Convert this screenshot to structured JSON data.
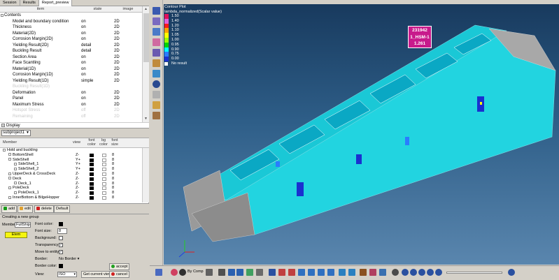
{
  "tabs": [
    "Session",
    "Results",
    "Report_preview"
  ],
  "grid1": {
    "headers": {
      "item": "item",
      "state": "state",
      "image": "image"
    },
    "rows": [
      {
        "item": "Contents",
        "state": "",
        "image": "",
        "group": true,
        "dim": false
      },
      {
        "item": "Model and boundary condition",
        "state": "on",
        "image": "2D",
        "group": false,
        "dim": false
      },
      {
        "item": "Thickness",
        "state": "on",
        "image": "2D",
        "group": false,
        "dim": false
      },
      {
        "item": "Material(2D)",
        "state": "on",
        "image": "2D",
        "group": false,
        "dim": false
      },
      {
        "item": "Corrosion Margin(2D)",
        "state": "on",
        "image": "2D",
        "group": false,
        "dim": false
      },
      {
        "item": "Yielding Result(2D)",
        "state": "detail",
        "image": "2D",
        "group": false,
        "dim": false
      },
      {
        "item": "Buckling Result",
        "state": "detail",
        "image": "2D",
        "group": false,
        "dim": false
      },
      {
        "item": "Section Area",
        "state": "on",
        "image": "2D",
        "group": false,
        "dim": false
      },
      {
        "item": "Face Scantling",
        "state": "on",
        "image": "2D",
        "group": false,
        "dim": false
      },
      {
        "item": "Material(1D)",
        "state": "on",
        "image": "2D",
        "group": false,
        "dim": false
      },
      {
        "item": "Corrosion Margin(1D)",
        "state": "on",
        "image": "2D",
        "group": false,
        "dim": false
      },
      {
        "item": "Yielding Result(1D)",
        "state": "simple",
        "image": "2D",
        "group": false,
        "dim": false
      },
      {
        "item": "Buckling Result(1D)",
        "state": "",
        "image": "",
        "group": false,
        "dim": true
      },
      {
        "item": "Deformation",
        "state": "on",
        "image": "2D",
        "group": false,
        "dim": false
      },
      {
        "item": "Panel",
        "state": "on",
        "image": "2D",
        "group": false,
        "dim": false
      },
      {
        "item": "Maximum Stress",
        "state": "on",
        "image": "2D",
        "group": false,
        "dim": false
      },
      {
        "item": "Hotspot Stress",
        "state": "off",
        "image": "2D",
        "group": false,
        "dim": true
      },
      {
        "item": "Remaining",
        "state": "off",
        "image": "2D",
        "group": false,
        "dim": true
      }
    ]
  },
  "display_label": "Display",
  "subproject": "subproject1",
  "grid2": {
    "headers": {
      "member": "Member",
      "view": "view",
      "font_color": "font color",
      "bg_color": "bg color",
      "font_size": "font size"
    },
    "rows": [
      {
        "name": "Hold and buckling",
        "view": "",
        "indent": 0,
        "sizes": false
      },
      {
        "name": "BottomShell",
        "view": "Z-",
        "indent": 1,
        "sizes": true
      },
      {
        "name": "SideShell",
        "view": "Y+",
        "indent": 1,
        "sizes": true
      },
      {
        "name": "SideShell_1",
        "view": "Y+",
        "indent": 2,
        "sizes": true
      },
      {
        "name": "SideShell_2",
        "view": "Y+",
        "indent": 2,
        "sizes": true
      },
      {
        "name": "UpperDeck & CrossDeck",
        "view": "Z-",
        "indent": 1,
        "sizes": true
      },
      {
        "name": "Deck",
        "view": "Z-",
        "indent": 1,
        "sizes": true
      },
      {
        "name": "Deck_1",
        "view": "Z-",
        "indent": 2,
        "sizes": true
      },
      {
        "name": "PoleDeck",
        "view": "Z-",
        "indent": 1,
        "sizes": true
      },
      {
        "name": "PoleDeck_1",
        "view": "Z-",
        "indent": 2,
        "sizes": true
      },
      {
        "name": "InnerBottom & BilgeHopper",
        "view": "Z-",
        "indent": 1,
        "sizes": true
      }
    ],
    "font_size_value": "8"
  },
  "buttons": {
    "add": "add",
    "edit": "edit",
    "delete": "delete",
    "default": "Default"
  },
  "create": {
    "title": "Creating a new group",
    "member_label": "Member",
    "member_value": "FullShip",
    "elem_button": "Elem",
    "font_color_label": "Font color:",
    "font_size_label": "Font size:",
    "font_size_value": "8",
    "background_label": "Background:",
    "transparency_label": "Transparency:",
    "move_label": "Move to entity:",
    "border_label": "Border:",
    "border_value": "No Border",
    "border_color_label": "Border color:",
    "view_label": "View:",
    "view_value": "ISO",
    "get_view_button": "Get current view",
    "accept_button": "accept",
    "cancel_button": "cancel"
  },
  "viewport": {
    "legend_title": "Contour Plot",
    "legend_subtitle": "lambda_normalized(Scalar value)",
    "legend_levels": [
      {
        "value": "1.50",
        "color": "#e0105a"
      },
      {
        "value": "1.40",
        "color": "#e060d8"
      },
      {
        "value": "1.20",
        "color": "#ff1a1a"
      },
      {
        "value": "1.10",
        "color": "#ffa000"
      },
      {
        "value": "1.05",
        "color": "#ffff00"
      },
      {
        "value": "1.00",
        "color": "#9cff00"
      },
      {
        "value": "0.95",
        "color": "#00d400"
      },
      {
        "value": "0.90",
        "color": "#00ffff"
      },
      {
        "value": "0.75",
        "color": "#2a7cff"
      },
      {
        "value": "0.00",
        "color": "#1a30d0"
      }
    ],
    "no_result": "No result",
    "info": [
      "231942",
      "1_HSM-1",
      "1.261"
    ]
  },
  "bottom_toolbar": {
    "by_comp": "By Comp"
  }
}
